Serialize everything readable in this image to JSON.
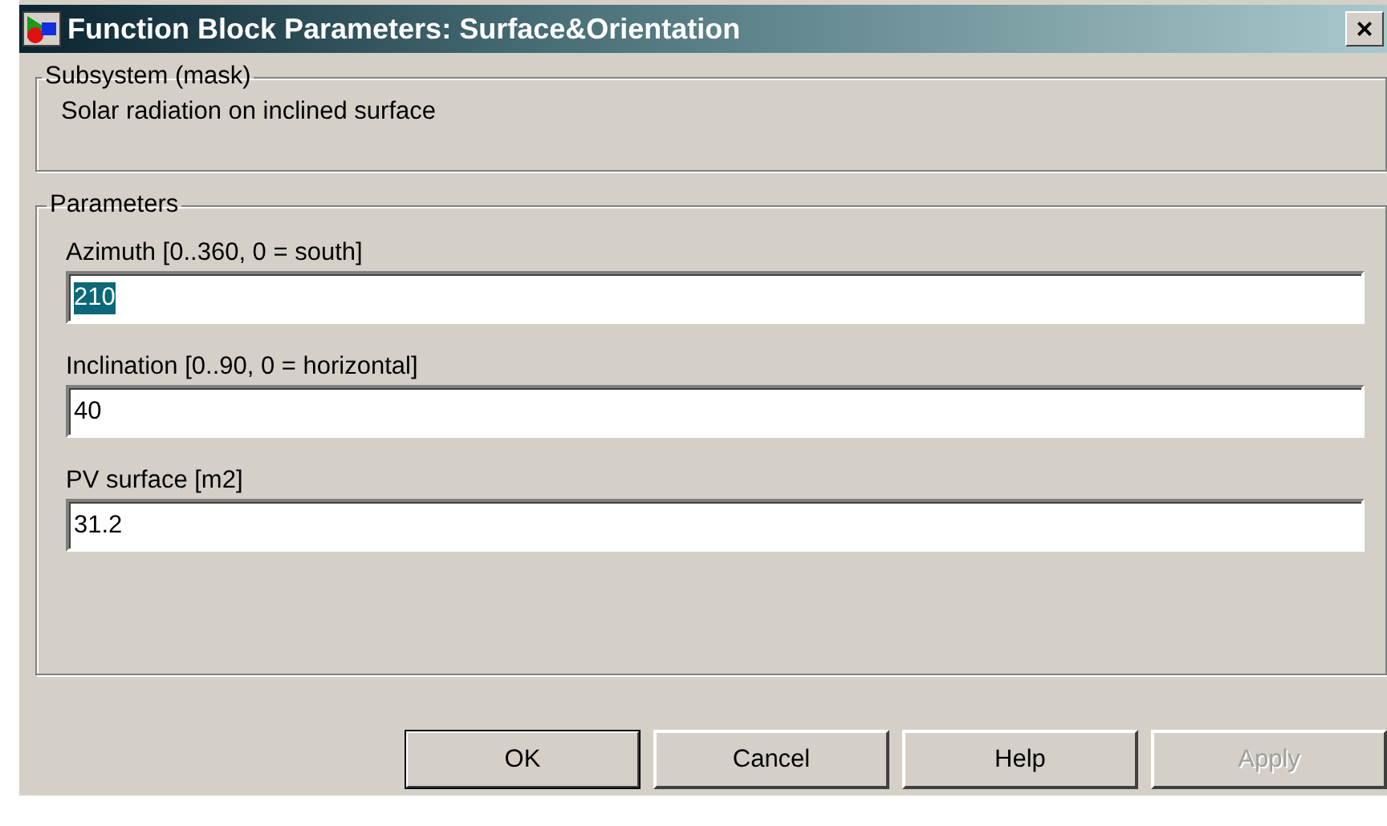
{
  "window": {
    "title": "Function Block Parameters: Surface&Orientation",
    "close": "×"
  },
  "description_group": {
    "title": "Subsystem (mask)",
    "text": "Solar radiation on inclined surface"
  },
  "parameters_group": {
    "title": "Parameters",
    "fields": [
      {
        "label": "Azimuth [0..360, 0 = south]",
        "value": "210",
        "selected": true
      },
      {
        "label": "Inclination [0..90, 0 = horizontal]",
        "value": "40",
        "selected": false
      },
      {
        "label": "PV surface [m2]",
        "value": "31.2",
        "selected": false
      }
    ]
  },
  "buttons": [
    {
      "label": "OK",
      "default": true,
      "disabled": false
    },
    {
      "label": "Cancel",
      "default": false,
      "disabled": false
    },
    {
      "label": "Help",
      "default": false,
      "disabled": false
    },
    {
      "label": "Apply",
      "default": false,
      "disabled": true
    }
  ]
}
